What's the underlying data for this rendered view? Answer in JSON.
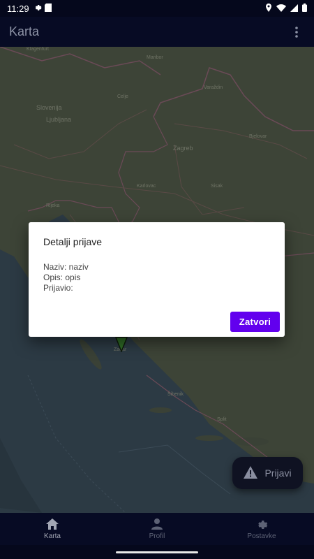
{
  "status": {
    "time": "11:29",
    "icons": [
      "gear-icon",
      "sd-card-icon",
      "location-icon",
      "wifi-icon",
      "signal-icon",
      "battery-icon"
    ]
  },
  "appbar": {
    "title": "Karta",
    "menu_icon": "more-vert-icon"
  },
  "map": {
    "places": [
      "Maribor",
      "Varaždin",
      "Slovenija",
      "Ljubljana",
      "Celje",
      "Zagreb",
      "Bjelovar",
      "Karlovac",
      "Sisak",
      "Rijeka",
      "Zadar",
      "Šibenik",
      "Split",
      "Klagenfurt"
    ],
    "marker_icon": "map-pin-icon"
  },
  "dialog": {
    "title": "Detalji prijave",
    "naziv": "Naziv: naziv",
    "opis": "Opis: opis",
    "prijavio": "Prijavio:",
    "close_label": "Zatvori"
  },
  "fab": {
    "label": "Prijavi",
    "icon": "warning-icon"
  },
  "nav": [
    {
      "label": "Karta",
      "icon": "home-icon",
      "active": true
    },
    {
      "label": "Profil",
      "icon": "person-icon",
      "active": false
    },
    {
      "label": "Postavke",
      "icon": "gear-icon",
      "active": false
    }
  ],
  "colors": {
    "accent": "#6200ee",
    "bar_bg": "#070b24"
  }
}
